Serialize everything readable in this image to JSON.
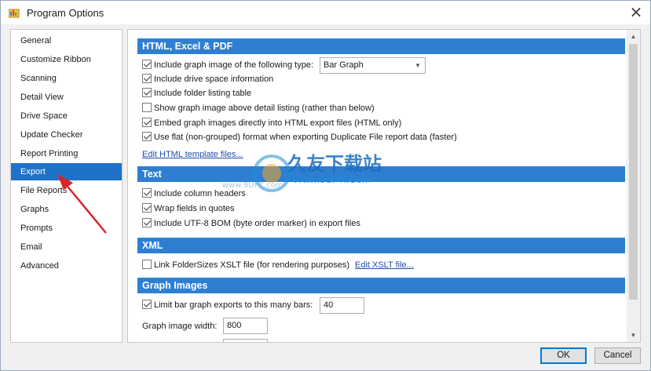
{
  "window": {
    "title": "Program Options"
  },
  "sidebar": {
    "items": [
      {
        "label": "General"
      },
      {
        "label": "Customize Ribbon"
      },
      {
        "label": "Scanning"
      },
      {
        "label": "Detail View"
      },
      {
        "label": "Drive Space"
      },
      {
        "label": "Update Checker"
      },
      {
        "label": "Report Printing"
      },
      {
        "label": "Export",
        "selected": true
      },
      {
        "label": "File Reports"
      },
      {
        "label": "Graphs"
      },
      {
        "label": "Prompts"
      },
      {
        "label": "Email"
      },
      {
        "label": "Advanced"
      }
    ]
  },
  "sections": {
    "html": {
      "title": "HTML, Excel & PDF",
      "options": [
        {
          "label": "Include graph image of the following type:",
          "checked": true
        },
        {
          "label": "Include drive space information",
          "checked": true
        },
        {
          "label": "Include folder listing table",
          "checked": true
        },
        {
          "label": "Show graph image above detail listing (rather than below)",
          "checked": false
        },
        {
          "label": "Embed graph images directly into HTML export files (HTML only)",
          "checked": true
        },
        {
          "label": "Use flat (non-grouped) format when exporting Duplicate File report data (faster)",
          "checked": true
        }
      ],
      "graph_type_value": "Bar Graph",
      "edit_template_link": "Edit HTML template files..."
    },
    "text": {
      "title": "Text",
      "options": [
        {
          "label": "Include column headers",
          "checked": true
        },
        {
          "label": "Wrap fields in quotes",
          "checked": true
        },
        {
          "label": "Include UTF-8 BOM (byte order marker) in export files",
          "checked": true
        }
      ]
    },
    "xml": {
      "title": "XML",
      "options": [
        {
          "label": "Link FolderSizes XSLT file (for rendering purposes)",
          "checked": false
        }
      ],
      "edit_xslt_link": "Edit XSLT file..."
    },
    "graph_images": {
      "title": "Graph Images",
      "limit_label": "Limit bar graph exports to this many bars:",
      "limit_checked": true,
      "limit_value": "40",
      "width_label": "Graph image width:",
      "width_value": "800"
    }
  },
  "watermark": {
    "text": "久友下载站",
    "url": "Www.9UPK.Com",
    "partial_url": "www.9UPK.com"
  },
  "buttons": {
    "ok": "OK",
    "cancel": "Cancel"
  },
  "colors": {
    "accent": "#2e7fd1",
    "selected": "#1f72c9",
    "annotation_arrow": "#d9262a"
  },
  "icons": {
    "app": "folder-chart-icon",
    "close": "close-icon"
  }
}
